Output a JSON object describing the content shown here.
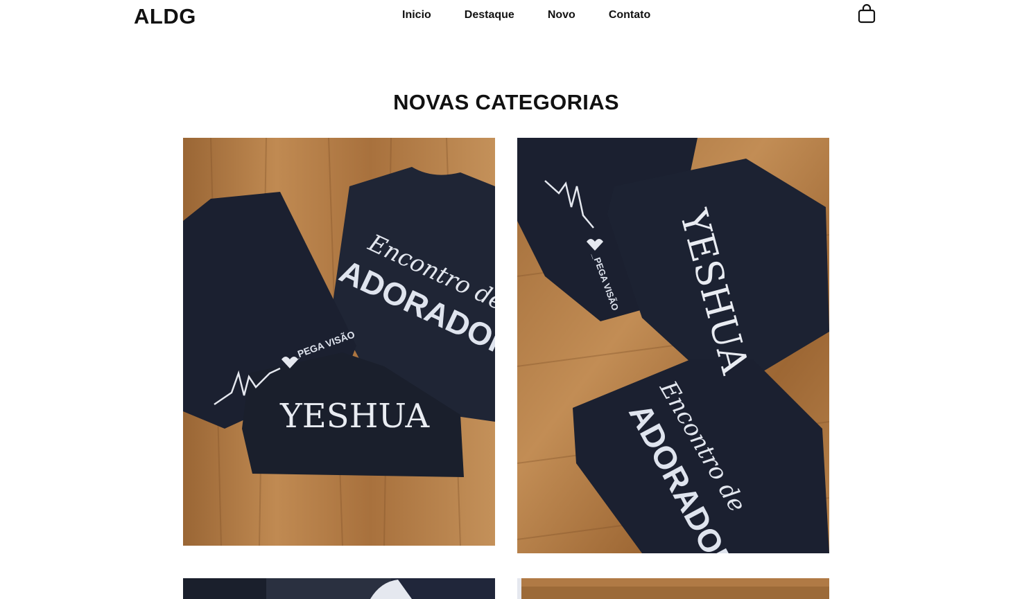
{
  "header": {
    "logo": "ALDG",
    "nav": [
      {
        "label": "Inicio"
      },
      {
        "label": "Destaque"
      },
      {
        "label": "Novo"
      },
      {
        "label": "Contato"
      }
    ],
    "cart_icon": "shopping-bag-icon"
  },
  "section": {
    "title": "NOVAS CATEGORIAS"
  },
  "products": [
    {
      "shirt_texts": [
        "YESHUA",
        "Encontro de",
        "ADORADORES",
        "_PEGA VISÃO"
      ]
    },
    {
      "shirt_texts": [
        "YESHUA",
        "Encontro de",
        "ADORADORES",
        "_PEGA VISÃO"
      ]
    }
  ],
  "colors": {
    "wood": "#b07a45",
    "wood_dark": "#8a5a2e",
    "shirt": "#1d2230",
    "print": "#e6e9f0"
  }
}
